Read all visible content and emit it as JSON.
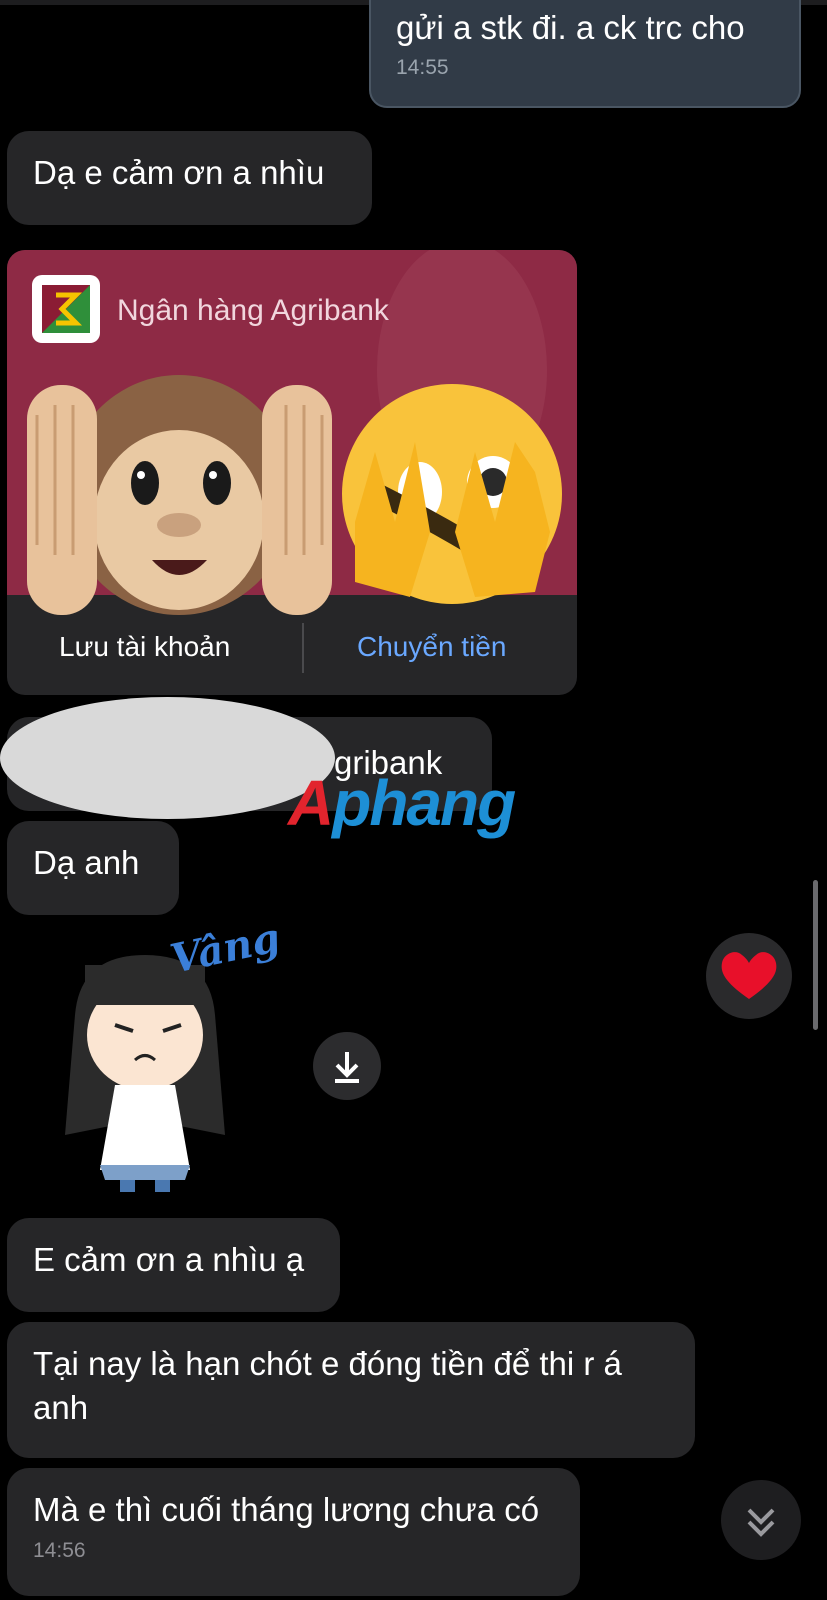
{
  "chat": {
    "outgoing_top": {
      "text": "gửi a stk đi. a ck trc cho",
      "time": "14:55"
    },
    "msg_thanks": "Dạ e cảm ơn a nhìu",
    "bank_card": {
      "bank_name": "Ngân hàng Agribank",
      "save_label": "Lưu tài khoản",
      "transfer_label": "Chuyển tiền"
    },
    "redacted_account_suffix": "gribank",
    "watermark": {
      "a": "A",
      "rest": "phang"
    },
    "msg_da_anh": "Dạ anh",
    "sticker_text": "Vâng",
    "msg_thanks2": "E cảm ơn a nhìu ạ",
    "msg_deadline": "Tại nay là hạn chót e đóng tiền để thi r á anh",
    "msg_salary": {
      "text": "Mà e thì cuối tháng lương chưa có",
      "time": "14:56"
    }
  },
  "colors": {
    "accent_link": "#6aa8ff",
    "card_bg": "#8e2a45",
    "bubble_bg": "#262628"
  }
}
